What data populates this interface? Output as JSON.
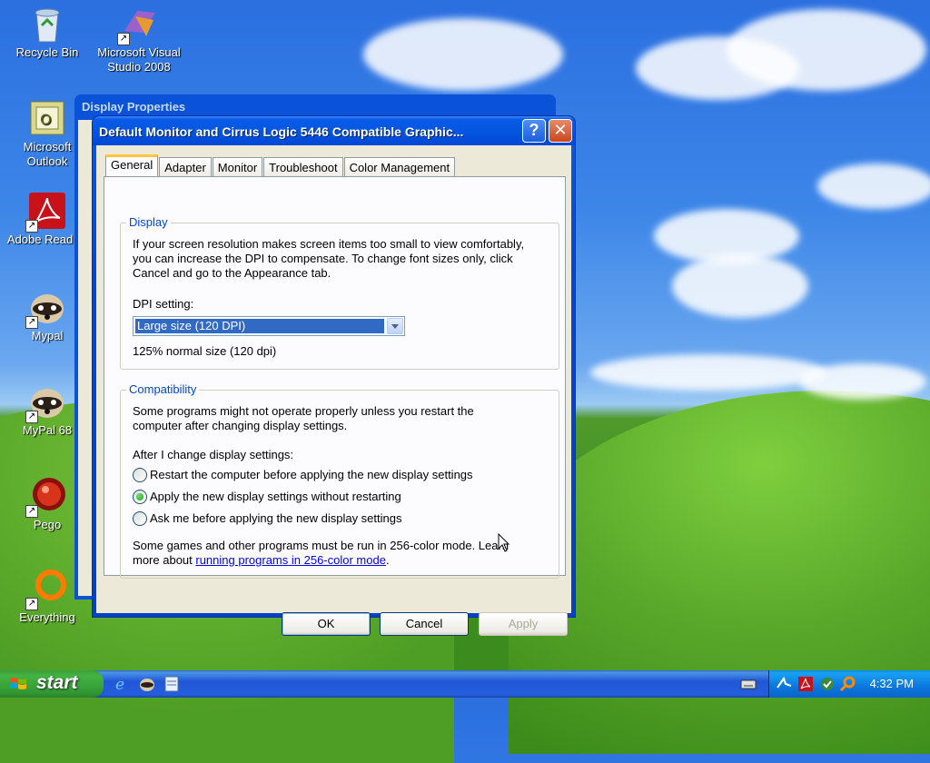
{
  "desktop": {
    "icons": [
      {
        "label": "Recycle Bin",
        "icon": "recycle-bin-icon"
      },
      {
        "label": "Microsoft Visual Studio 2008",
        "icon": "visual-studio-icon"
      },
      {
        "label": "Microsoft Outlook",
        "icon": "outlook-icon"
      },
      {
        "label": "Adobe Read XI",
        "icon": "adobe-reader-icon"
      },
      {
        "label": "Mypal",
        "icon": "mypal-icon"
      },
      {
        "label": "MyPal 68",
        "icon": "mypal-icon"
      },
      {
        "label": "Pego",
        "icon": "pego-icon"
      },
      {
        "label": "Everything",
        "icon": "everything-search-icon"
      }
    ]
  },
  "back_window": {
    "title": "Display Properties"
  },
  "dialog": {
    "title": "Default Monitor and Cirrus Logic 5446 Compatible Graphic...",
    "help_symbol": "?",
    "close_symbol": "✕",
    "tabs": [
      "General",
      "Adapter",
      "Monitor",
      "Troubleshoot",
      "Color Management"
    ],
    "active_tab": "General",
    "display_group": {
      "title": "Display",
      "description_line1": "If your screen resolution makes screen items too small to view comfortably,",
      "description_line2": "you can increase the DPI to compensate.  To change font sizes only, click",
      "description_line3": "Cancel and go to the Appearance tab.",
      "dpi_label": "DPI setting:",
      "dpi_value": "Large size (120 DPI)",
      "dpi_note": "125% normal size (120 dpi)"
    },
    "compat_group": {
      "title": "Compatibility",
      "line1": "Some programs might not operate properly unless you restart the",
      "line2": "computer after changing display settings.",
      "after_label": "After I change display settings:",
      "options": [
        {
          "label": "Restart the computer before applying the new display settings",
          "checked": false
        },
        {
          "label": "Apply the new display settings without restarting",
          "checked": true
        },
        {
          "label": "Ask me before applying the new display settings",
          "checked": false
        }
      ],
      "games_line1": "Some games and other programs must be run in 256-color mode.  Learn",
      "games_prefix": "more about ",
      "games_link": "running programs in 256-color mode",
      "games_suffix": "."
    },
    "buttons": {
      "ok": "OK",
      "cancel": "Cancel",
      "apply": "Apply"
    }
  },
  "taskbar": {
    "start_label": "start",
    "quick_launch": [
      "internet-explorer-icon",
      "mypal-icon",
      "notepad-icon"
    ],
    "tray_icons": [
      "keyboard-icon",
      "network-icon",
      "adobe-icon",
      "update-icon",
      "search-icon"
    ],
    "clock": "4:32 PM"
  }
}
